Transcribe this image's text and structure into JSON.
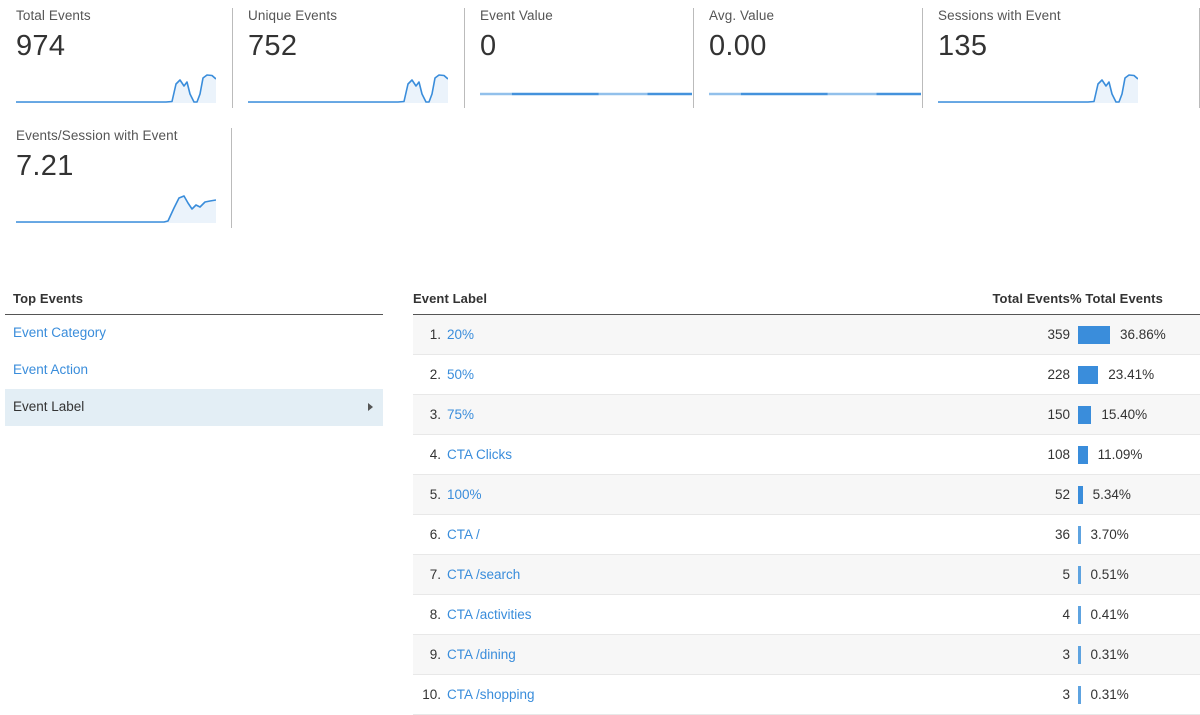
{
  "scorecards": [
    {
      "label": "Total Events",
      "value": "974",
      "spark": "peaks"
    },
    {
      "label": "Unique Events",
      "value": "752",
      "spark": "peaks"
    },
    {
      "label": "Event Value",
      "value": "0",
      "spark": "flat"
    },
    {
      "label": "Avg. Value",
      "value": "0.00",
      "spark": "flat"
    },
    {
      "label": "Sessions with Event",
      "value": "135",
      "spark": "peaks"
    },
    {
      "label": "Events/Session with Event",
      "value": "7.21",
      "spark": "rise"
    }
  ],
  "top_events": {
    "title": "Top Events",
    "items": [
      {
        "label": "Event Category",
        "selected": false
      },
      {
        "label": "Event Action",
        "selected": false
      },
      {
        "label": "Event Label",
        "selected": true
      }
    ]
  },
  "table": {
    "columns": {
      "label": "Event Label",
      "total": "Total Events",
      "pct": "% Total Events"
    },
    "rows": [
      {
        "rank": "1.",
        "label": "20%",
        "total": "359",
        "pct": "36.86%"
      },
      {
        "rank": "2.",
        "label": "50%",
        "total": "228",
        "pct": "23.41%"
      },
      {
        "rank": "3.",
        "label": "75%",
        "total": "150",
        "pct": "15.40%"
      },
      {
        "rank": "4.",
        "label": "CTA Clicks",
        "total": "108",
        "pct": "11.09%"
      },
      {
        "rank": "5.",
        "label": "100%",
        "total": "52",
        "pct": "5.34%"
      },
      {
        "rank": "6.",
        "label": "CTA /",
        "total": "36",
        "pct": "3.70%"
      },
      {
        "rank": "7.",
        "label": "CTA /search",
        "total": "5",
        "pct": "0.51%"
      },
      {
        "rank": "8.",
        "label": "CTA /activities",
        "total": "4",
        "pct": "0.41%"
      },
      {
        "rank": "9.",
        "label": "CTA /dining",
        "total": "3",
        "pct": "0.31%"
      },
      {
        "rank": "10.",
        "label": "CTA /shopping",
        "total": "3",
        "pct": "0.31%"
      }
    ]
  },
  "chart_data": {
    "type": "bar",
    "title": "Top Events — Event Label",
    "xlabel": "Event Label",
    "ylabel": "Total Events",
    "categories": [
      "20%",
      "50%",
      "75%",
      "CTA Clicks",
      "100%",
      "CTA /",
      "CTA /search",
      "CTA /activities",
      "CTA /dining",
      "CTA /shopping"
    ],
    "values": [
      359,
      228,
      150,
      108,
      52,
      36,
      5,
      4,
      3,
      3
    ],
    "percent_of_total": [
      36.86,
      23.41,
      15.4,
      11.09,
      5.34,
      3.7,
      0.51,
      0.41,
      0.31,
      0.31
    ],
    "total_events_all": 974,
    "grid": false,
    "legend": "none",
    "orientation": "horizontal",
    "bar_color": "#3a8ddb",
    "max_bar_pct": 36.86
  },
  "colors": {
    "link": "#3a8ddb",
    "bar": "#3a8ddb",
    "bar_sliver": "#5ea3e0",
    "selected_row": "#e3eef5",
    "stripe": "#f7f7f7",
    "text": "#333333",
    "label_text": "#555555",
    "rule": "#555555",
    "divider": "#bbbbbb"
  }
}
